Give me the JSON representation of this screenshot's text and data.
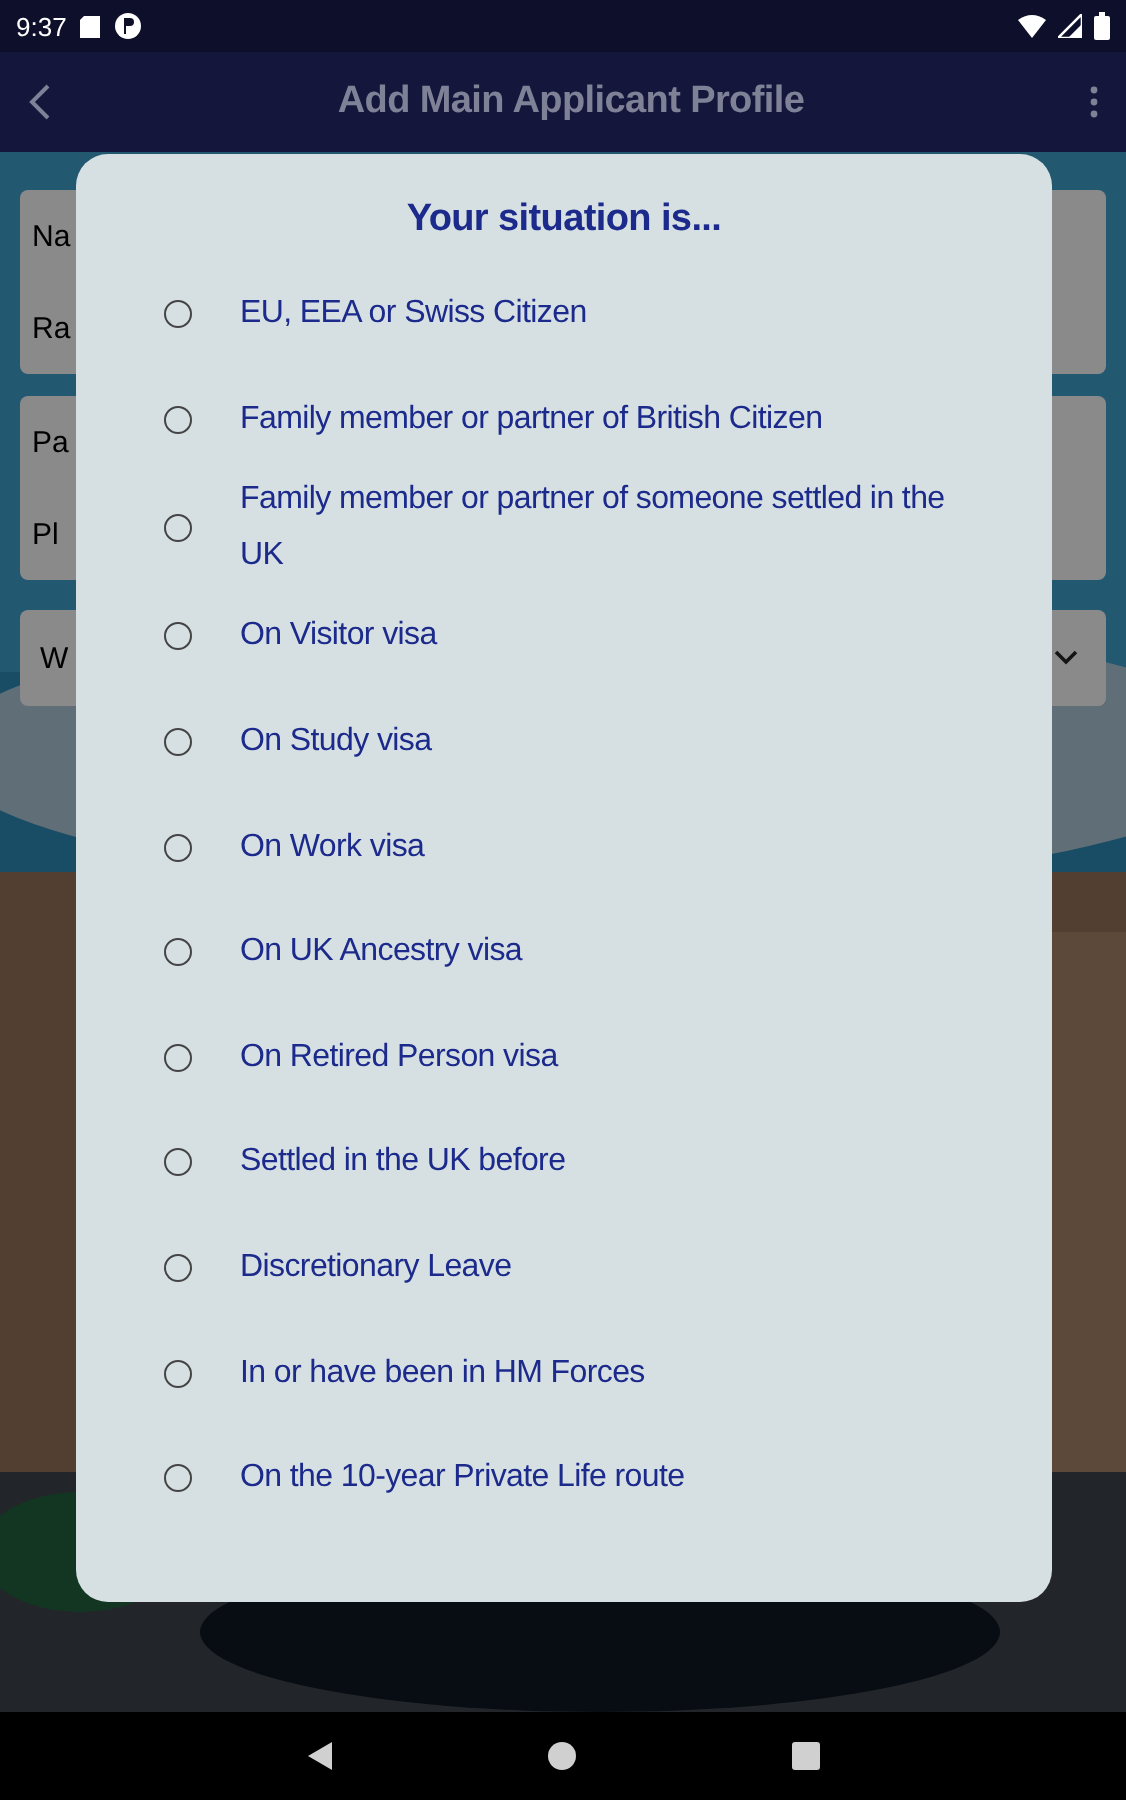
{
  "status_bar": {
    "time": "9:37"
  },
  "app_bar": {
    "title": "Add Main Applicant Profile"
  },
  "form_fields": [
    {
      "kind": "text",
      "label": "Na",
      "value": "Ra"
    },
    {
      "kind": "text",
      "label": "Pa",
      "value": "Pl"
    },
    {
      "kind": "dropdown",
      "value": "W"
    }
  ],
  "dialog": {
    "title": "Your situation is...",
    "options": [
      {
        "label": "EU, EEA or Swiss Citizen",
        "selected": false
      },
      {
        "label": "Family member or partner of British Citizen",
        "selected": false
      },
      {
        "label": "Family member or partner of someone settled in the UK",
        "selected": false
      },
      {
        "label": "On Visitor visa",
        "selected": false
      },
      {
        "label": "On Study visa",
        "selected": false
      },
      {
        "label": "On Work visa",
        "selected": false
      },
      {
        "label": "On UK Ancestry visa",
        "selected": false
      },
      {
        "label": "On Retired Person visa",
        "selected": false
      },
      {
        "label": "Settled in the UK before",
        "selected": false
      },
      {
        "label": "Discretionary Leave",
        "selected": false
      },
      {
        "label": "In or have been in HM Forces",
        "selected": false
      },
      {
        "label": "On the 10-year Private Life route",
        "selected": false
      }
    ]
  }
}
